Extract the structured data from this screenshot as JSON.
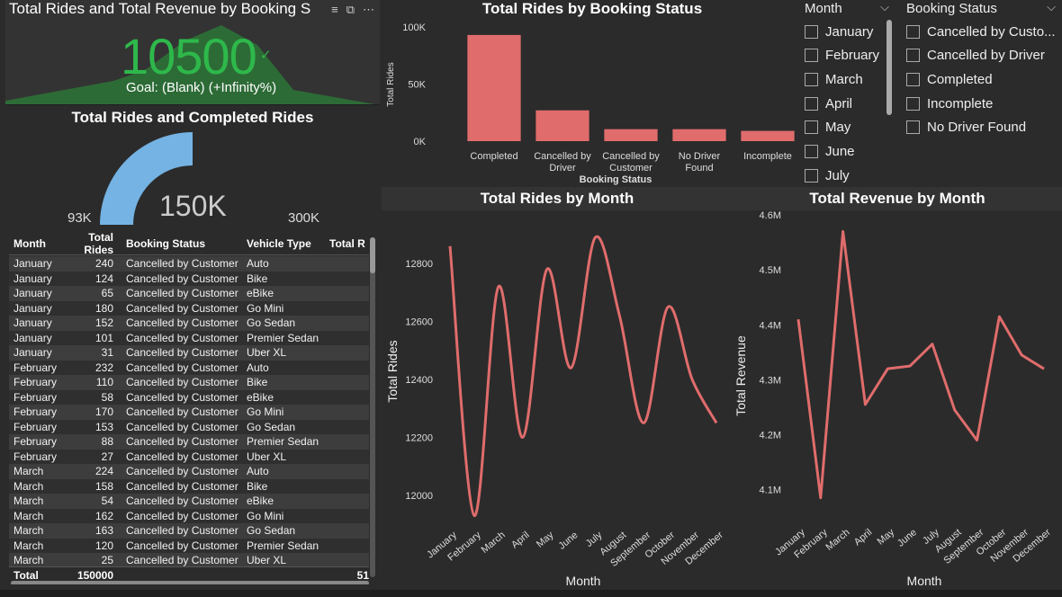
{
  "kpi": {
    "title": "Total Rides and Total Revenue by Booking S",
    "value": "10500",
    "check": "✓",
    "goal": "Goal: (Blank) (+Infinity%)",
    "tools": [
      "≡",
      "⧉",
      "⋯"
    ],
    "color": "#2eb84b"
  },
  "gauge": {
    "title": "Total Rides and Completed Rides",
    "min": "93K",
    "value": "150K",
    "max": "300K",
    "fill_fraction": 0.5,
    "color": "#74b3e3"
  },
  "table": {
    "headers": [
      "Month",
      "Total Rides",
      "Booking Status",
      "Vehicle Type",
      "Total R"
    ],
    "rows": [
      [
        "January",
        "240",
        "Cancelled by Customer",
        "Auto",
        ""
      ],
      [
        "January",
        "124",
        "Cancelled by Customer",
        "Bike",
        ""
      ],
      [
        "January",
        "65",
        "Cancelled by Customer",
        "eBike",
        ""
      ],
      [
        "January",
        "180",
        "Cancelled by Customer",
        "Go Mini",
        ""
      ],
      [
        "January",
        "152",
        "Cancelled by Customer",
        "Go Sedan",
        ""
      ],
      [
        "January",
        "101",
        "Cancelled by Customer",
        "Premier Sedan",
        ""
      ],
      [
        "January",
        "31",
        "Cancelled by Customer",
        "Uber XL",
        ""
      ],
      [
        "February",
        "232",
        "Cancelled by Customer",
        "Auto",
        ""
      ],
      [
        "February",
        "110",
        "Cancelled by Customer",
        "Bike",
        ""
      ],
      [
        "February",
        "58",
        "Cancelled by Customer",
        "eBike",
        ""
      ],
      [
        "February",
        "170",
        "Cancelled by Customer",
        "Go Mini",
        ""
      ],
      [
        "February",
        "153",
        "Cancelled by Customer",
        "Go Sedan",
        ""
      ],
      [
        "February",
        "88",
        "Cancelled by Customer",
        "Premier Sedan",
        ""
      ],
      [
        "February",
        "27",
        "Cancelled by Customer",
        "Uber XL",
        ""
      ],
      [
        "March",
        "224",
        "Cancelled by Customer",
        "Auto",
        ""
      ],
      [
        "March",
        "158",
        "Cancelled by Customer",
        "Bike",
        ""
      ],
      [
        "March",
        "54",
        "Cancelled by Customer",
        "eBike",
        ""
      ],
      [
        "March",
        "162",
        "Cancelled by Customer",
        "Go Mini",
        ""
      ],
      [
        "March",
        "163",
        "Cancelled by Customer",
        "Go Sedan",
        ""
      ],
      [
        "March",
        "120",
        "Cancelled by Customer",
        "Premier Sedan",
        ""
      ],
      [
        "March",
        "25",
        "Cancelled by Customer",
        "Uber XL",
        ""
      ]
    ],
    "total": {
      "label": "Total",
      "rides": "150000",
      "revenue": "51"
    }
  },
  "slicers": {
    "month": {
      "label": "Month",
      "items": [
        "January",
        "February",
        "March",
        "April",
        "May",
        "June",
        "July"
      ]
    },
    "status": {
      "label": "Booking Status",
      "items": [
        "Cancelled by Custo...",
        "Cancelled by Driver",
        "Completed",
        "Incomplete",
        "No Driver Found"
      ]
    }
  },
  "chart_data": [
    {
      "type": "bar",
      "title": "Total Rides by Booking Status",
      "xlabel": "Booking Status",
      "ylabel": "Total Rides",
      "categories": [
        "Completed",
        "Cancelled by Driver",
        "Cancelled by Customer",
        "No Driver Found",
        "Incomplete"
      ],
      "category_lines": [
        [
          "Completed"
        ],
        [
          "Cancelled by",
          "Driver"
        ],
        [
          "Cancelled by",
          "Customer"
        ],
        [
          "No Driver",
          "Found"
        ],
        [
          "Incomplete"
        ]
      ],
      "values": [
        93000,
        27000,
        10500,
        10500,
        9000
      ],
      "ylim": [
        0,
        100000
      ],
      "yticks": [
        0,
        50000,
        100000
      ],
      "ytick_labels": [
        "0K",
        "50K",
        "100K"
      ],
      "color": "#e06c6c"
    },
    {
      "type": "line",
      "title": "Total Rides by Month",
      "xlabel": "Month",
      "ylabel": "Total Rides",
      "categories": [
        "January",
        "February",
        "March",
        "April",
        "May",
        "June",
        "July",
        "August",
        "September",
        "October",
        "November",
        "December"
      ],
      "values": [
        12860,
        11930,
        12720,
        12200,
        12780,
        12440,
        12890,
        12620,
        12250,
        12650,
        12400,
        12250
      ],
      "ylim": [
        11950,
        12940
      ],
      "yticks": [
        12000,
        12200,
        12400,
        12600,
        12800
      ],
      "ytick_labels": [
        "12000",
        "12200",
        "12400",
        "12600",
        "12800"
      ],
      "color": "#e06c6c"
    },
    {
      "type": "line",
      "title": "Total Revenue by Month",
      "xlabel": "Month",
      "ylabel": "Total Revenue",
      "categories": [
        "January",
        "February",
        "March",
        "April",
        "May",
        "June",
        "July",
        "August",
        "September",
        "October",
        "November",
        "December"
      ],
      "values": [
        4410000,
        4085000,
        4570000,
        4255000,
        4320000,
        4325000,
        4365000,
        4245000,
        4190000,
        4415000,
        4345000,
        4320000
      ],
      "ylim": [
        4060000,
        4610000
      ],
      "yticks": [
        4100000,
        4200000,
        4300000,
        4400000,
        4500000,
        4600000
      ],
      "ytick_labels": [
        "4.1M",
        "4.2M",
        "4.3M",
        "4.4M",
        "4.5M",
        "4.6M"
      ],
      "color": "#e06c6c"
    }
  ]
}
